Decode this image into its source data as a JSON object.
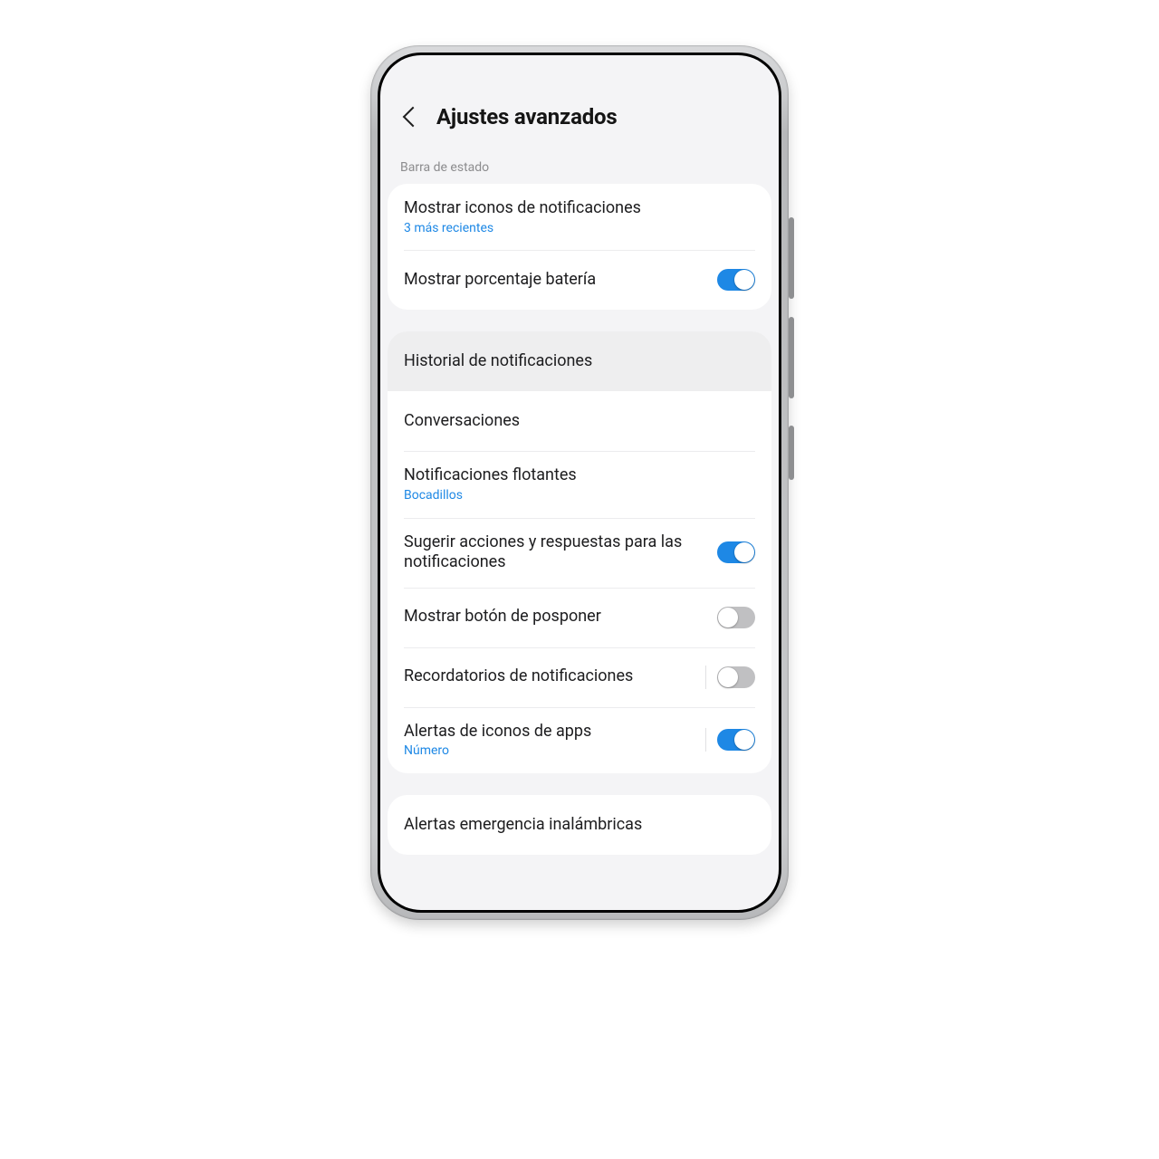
{
  "header": {
    "title": "Ajustes avanzados"
  },
  "group1": {
    "section_label": "Barra de estado",
    "rows": [
      {
        "title": "Mostrar iconos de notificaciones",
        "sub": "3 más recientes"
      },
      {
        "title": "Mostrar porcentaje batería",
        "toggle": true
      }
    ]
  },
  "group2": {
    "rows": [
      {
        "title": "Historial de notificaciones",
        "highlight": true
      },
      {
        "title": "Conversaciones"
      },
      {
        "title": "Notificaciones flotantes",
        "sub": "Bocadillos"
      },
      {
        "title": "Sugerir acciones y respuestas para las notificaciones",
        "toggle": true
      },
      {
        "title": "Mostrar botón de posponer",
        "toggle": false
      },
      {
        "title": "Recordatorios de notificaciones",
        "toggle": false,
        "vsep": true
      },
      {
        "title": "Alertas de iconos de apps",
        "sub": "Número",
        "toggle": true,
        "vsep": true
      }
    ]
  },
  "group3": {
    "rows": [
      {
        "title": "Alertas emergencia inalámbricas"
      }
    ]
  }
}
